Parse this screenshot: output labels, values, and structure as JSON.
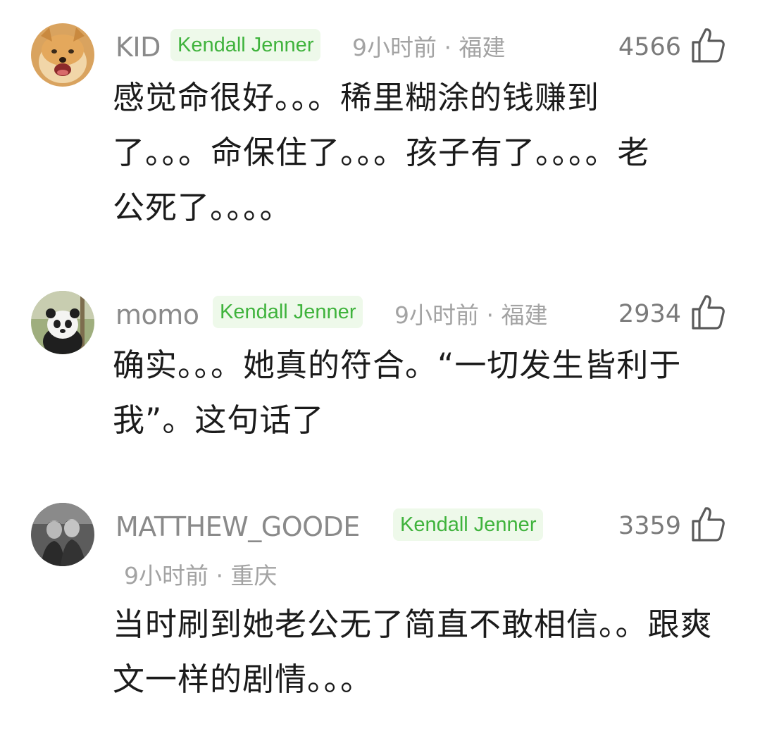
{
  "colors": {
    "badge_bg": "#eef9ea",
    "badge_text": "#3fb33c",
    "username": "#8a8a8a",
    "meta": "#a3a3a3",
    "body_text": "#1b1b1b"
  },
  "comments": [
    {
      "avatar": "shiba-dog-avatar",
      "username": "KID",
      "badge": "Kendall Jenner",
      "time": "9小时前",
      "separator": "·",
      "location": "福建",
      "likes": "4566",
      "like_icon": "thumbs-up-icon",
      "text": "感觉命很好。。。稀里糊涂的钱赚到了。。。命保住了。。。孩子有了。。。。老公死了。。。。"
    },
    {
      "avatar": "panda-avatar",
      "username": "momo",
      "badge": "Kendall Jenner",
      "time": "9小时前",
      "separator": "·",
      "location": "福建",
      "likes": "2934",
      "like_icon": "thumbs-up-icon",
      "text": "确实。。。她真的符合。“一切发生皆利于我”。这句话了"
    },
    {
      "avatar": "two-men-photo-avatar",
      "username": "MATTHEW_GOODE",
      "badge": "Kendall Jenner",
      "time": "9小时前",
      "separator": "·",
      "location": "重庆",
      "likes": "3359",
      "like_icon": "thumbs-up-icon",
      "text": "当时刷到她老公无了简直不敢相信。。跟爽文一样的剧情。。。"
    }
  ]
}
